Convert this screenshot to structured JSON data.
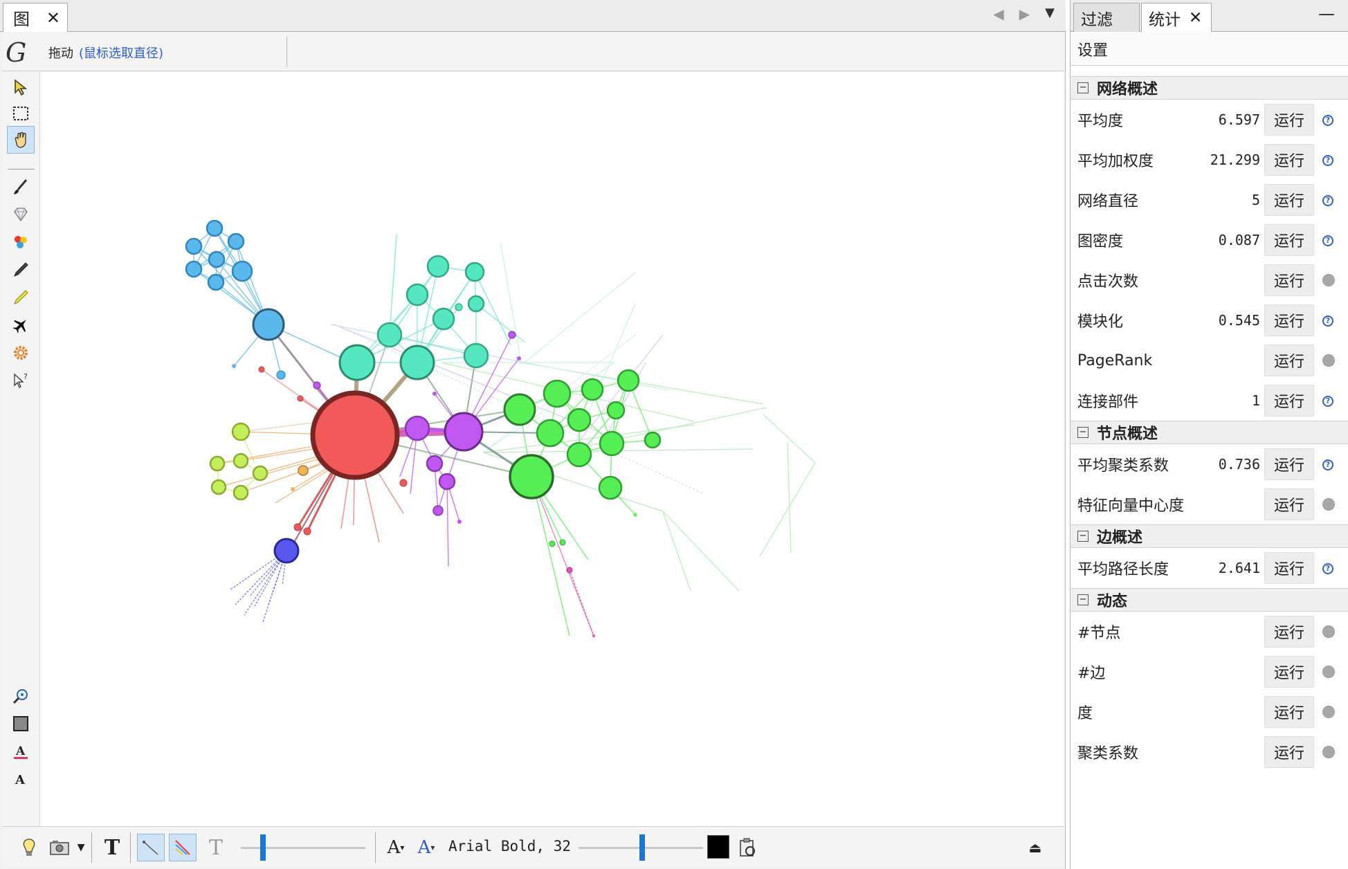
{
  "graph_window": {
    "tab_label": "图",
    "mode_label": "拖动",
    "mode_hint": "(鼠标选取直径)",
    "font_name": "Arial Bold, 32"
  },
  "stats_panel": {
    "tabs": [
      {
        "label": "过滤",
        "active": false
      },
      {
        "label": "统计",
        "active": true
      }
    ],
    "settings_label": "设置",
    "sections": [
      {
        "title": "网络概述",
        "rows": [
          {
            "name": "平均度",
            "value": "6.597",
            "run": "运行",
            "icon": "info"
          },
          {
            "name": "平均加权度",
            "value": "21.299",
            "run": "运行",
            "icon": "info"
          },
          {
            "name": "网络直径",
            "value": "5",
            "run": "运行",
            "icon": "info"
          },
          {
            "name": "图密度",
            "value": "0.087",
            "run": "运行",
            "icon": "info"
          },
          {
            "name": "点击次数",
            "value": "",
            "run": "运行",
            "icon": "dot"
          },
          {
            "name": "模块化",
            "value": "0.545",
            "run": "运行",
            "icon": "info"
          },
          {
            "name": "PageRank",
            "value": "",
            "run": "运行",
            "icon": "dot"
          },
          {
            "name": "连接部件",
            "value": "1",
            "run": "运行",
            "icon": "info"
          }
        ]
      },
      {
        "title": "节点概述",
        "rows": [
          {
            "name": "平均聚类系数",
            "value": "0.736",
            "run": "运行",
            "icon": "info"
          },
          {
            "name": "特征向量中心度",
            "value": "",
            "run": "运行",
            "icon": "dot"
          }
        ]
      },
      {
        "title": "边概述",
        "rows": [
          {
            "name": "平均路径长度",
            "value": "2.641",
            "run": "运行",
            "icon": "info"
          }
        ]
      },
      {
        "title": "动态",
        "rows": [
          {
            "name": "#节点",
            "value": "",
            "run": "运行",
            "icon": "dot"
          },
          {
            "name": "#边",
            "value": "",
            "run": "运行",
            "icon": "dot"
          },
          {
            "name": "度",
            "value": "",
            "run": "运行",
            "icon": "dot"
          },
          {
            "name": "聚类系数",
            "value": "",
            "run": "运行",
            "icon": "dot"
          }
        ]
      }
    ]
  },
  "colors": {
    "red": "#f25a5a",
    "purple": "#c057f0",
    "green": "#55ee55",
    "teal": "#55e7c0",
    "blue": "#5ab8ec",
    "lime": "#c3f05a",
    "indigo": "#5858f0",
    "accent": "#1b77d1"
  }
}
